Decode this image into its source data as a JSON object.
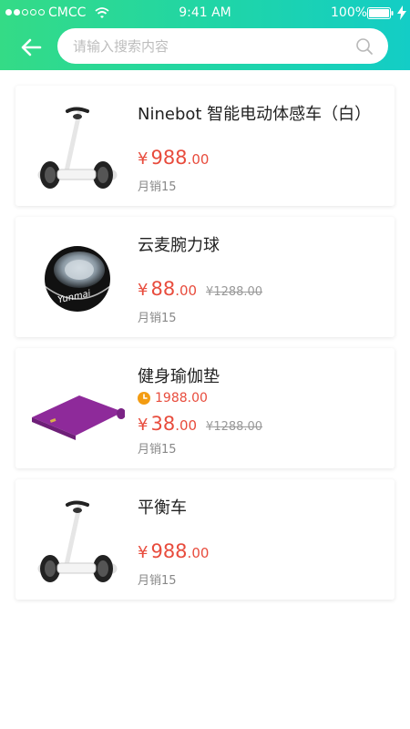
{
  "status_bar": {
    "carrier": "CMCC",
    "time": "9:41 AM",
    "battery": "100%"
  },
  "search": {
    "placeholder": "请输入搜索内容",
    "value": ""
  },
  "colors": {
    "header_start": "#34db86",
    "header_end": "#13cdc6",
    "price": "#e84c3d",
    "flash_icon": "#f39c12"
  },
  "products": [
    {
      "title": "Ninebot 智能电动体感车（白）",
      "currency": "¥",
      "price_int": "988",
      "price_dec": ".00",
      "original_price": "",
      "flash_price": "",
      "sales": "月销15",
      "image": "balance-scooter"
    },
    {
      "title": "云麦腕力球",
      "currency": "¥",
      "price_int": "88",
      "price_dec": ".00",
      "original_price": "¥1288.00",
      "flash_price": "",
      "sales": "月销15",
      "image": "wrist-ball",
      "image_text": "Yunmai"
    },
    {
      "title": "健身瑜伽垫",
      "currency": "¥",
      "price_int": "38",
      "price_dec": ".00",
      "original_price": "¥1288.00",
      "flash_price": "1988.00",
      "sales": "月销15",
      "image": "yoga-mat"
    },
    {
      "title": "平衡车",
      "currency": "¥",
      "price_int": "988",
      "price_dec": ".00",
      "original_price": "",
      "flash_price": "",
      "sales": "月销15",
      "image": "balance-scooter"
    }
  ]
}
